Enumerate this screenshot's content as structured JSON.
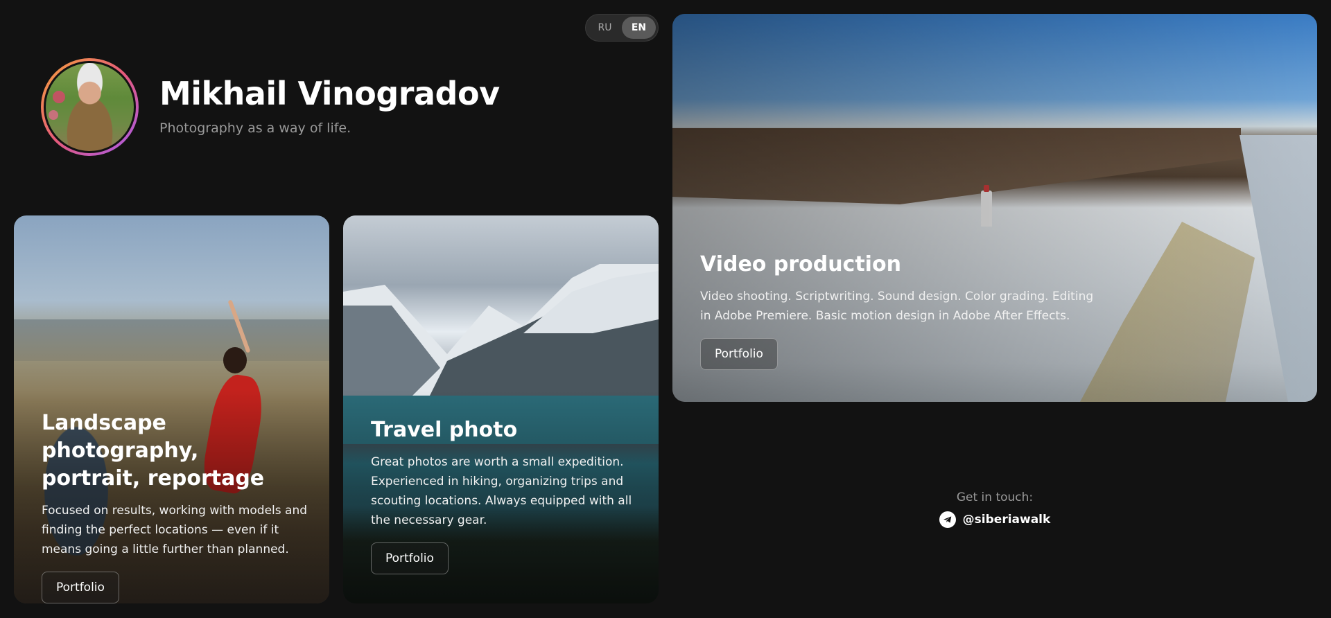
{
  "language_switch": {
    "options": [
      "RU",
      "EN"
    ],
    "active": "EN"
  },
  "header": {
    "name": "Mikhail Vinogradov",
    "tagline": "Photography as a way of life."
  },
  "cards": [
    {
      "title_line1": "Landscape photography,",
      "title_line2": "portrait, reportage",
      "description_line1": "Focused on results, working with models and",
      "description_line2": "finding the perfect locations — even if it",
      "description_line3": "means going a little further than planned.",
      "button": "Portfolio"
    },
    {
      "title": "Travel photo",
      "description_line1": "Great photos are worth a small expedition.",
      "description_line2": "Experienced in hiking, organizing trips and",
      "description_line3": "scouting locations. Always equipped with all",
      "description_line4": "the necessary gear.",
      "button": "Portfolio"
    },
    {
      "title": "Video production",
      "description_line1": "Video shooting. Scriptwriting. Sound design. Color grading. Editing",
      "description_line2": "in Adobe Premiere. Basic motion design in Adobe After Effects.",
      "button": "Portfolio"
    }
  ],
  "contact": {
    "label": "Get in touch:",
    "handle": "@siberiawalk",
    "icon": "telegram-icon"
  },
  "colors": {
    "background": "#121212",
    "avatar_gradient": [
      "#f6a43a",
      "#e55a7a",
      "#a55cf0"
    ]
  }
}
